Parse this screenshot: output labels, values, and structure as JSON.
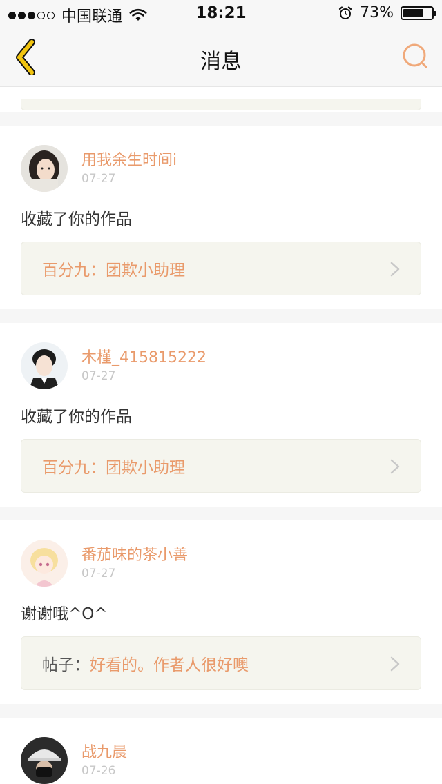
{
  "status_bar": {
    "carrier": "中国联通",
    "time": "18:21",
    "battery_percent": "73%",
    "battery_level": 0.73,
    "signal_bars_filled": 3,
    "signal_bars_total": 5
  },
  "nav": {
    "title": "消息",
    "back_icon": "chevron-left-icon",
    "search_icon": "search-icon"
  },
  "colors": {
    "accent": "#e99a6b",
    "back_icon": "#f1c40f",
    "search_icon": "#f0a97a"
  },
  "messages": [
    {
      "username": "用我余生时间i",
      "date": "07-27",
      "text": "收藏了你的作品",
      "work_label": "",
      "work_title": "百分九：团欺小助理"
    },
    {
      "username": "木槿_415815222",
      "date": "07-27",
      "text": "收藏了你的作品",
      "work_label": "",
      "work_title": "百分九：团欺小助理"
    },
    {
      "username": "番茄味的茶小善",
      "date": "07-27",
      "text": "谢谢哦^O^",
      "work_label": "帖子：",
      "work_title": "好看的。作者人很好噢"
    },
    {
      "username": "战九晨",
      "date": "07-26",
      "text": "",
      "work_label": "",
      "work_title": ""
    }
  ]
}
